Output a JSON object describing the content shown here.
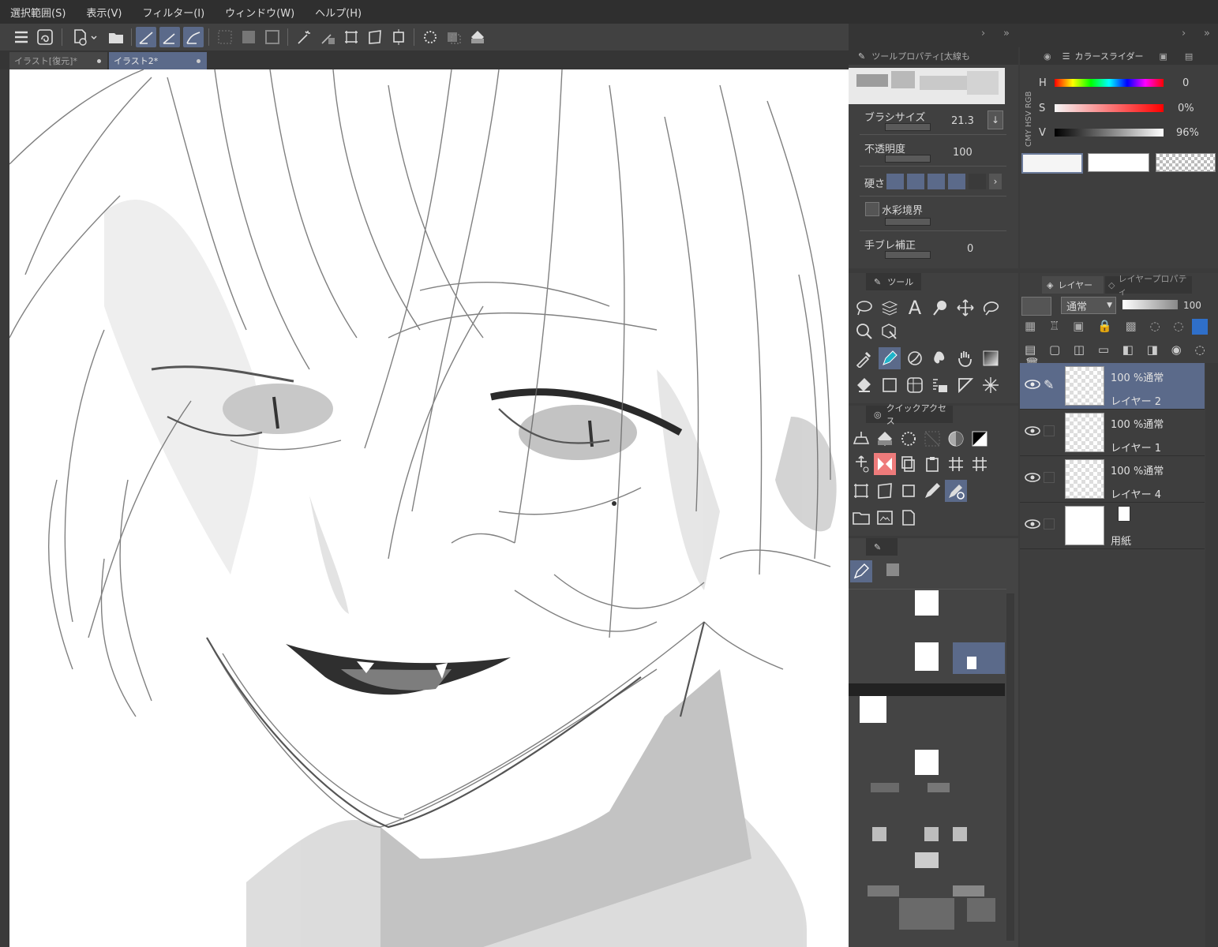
{
  "menu": [
    "選択範囲(S)",
    "表示(V)",
    "フィルター(I)",
    "ウィンドウ(W)",
    "ヘルプ(H)"
  ],
  "tabs": [
    {
      "label": "イラスト[復元]*",
      "active": false
    },
    {
      "label": "イラスト2*",
      "active": true
    }
  ],
  "tool_property": {
    "header": "ツールプロパティ[太線も",
    "brush_size_label": "ブラシサイズ",
    "brush_size_value": "21.3",
    "opacity_label": "不透明度",
    "opacity_value": "100",
    "hardness_label": "硬さ",
    "watercolor_edge_label": "水彩境界",
    "stabilization_label": "手ブレ補正",
    "stabilization_value": "0"
  },
  "color_slider": {
    "header": "カラースライダー",
    "side_tabs": [
      "RGB",
      "HSV",
      "CMY"
    ],
    "h_label": "H",
    "h_value": "0",
    "s_label": "S",
    "s_value": "0%",
    "v_label": "V",
    "v_value": "96%",
    "main_color": "#f5f5f5",
    "sub_color": "#ffffff"
  },
  "tool_panel": {
    "header": "ツール"
  },
  "quick_access": {
    "header": "クイックアクセス"
  },
  "layer_panel": {
    "tab_layer": "レイヤー",
    "tab_property": "レイヤープロパティ",
    "blend_mode": "通常",
    "opacity": "100",
    "layers": [
      {
        "mode": "100 %通常",
        "name": "レイヤー 2",
        "selected": true
      },
      {
        "mode": "100 %通常",
        "name": "レイヤー 1",
        "selected": false
      },
      {
        "mode": "100 %通常",
        "name": "レイヤー 4",
        "selected": false
      },
      {
        "mode": "",
        "name": "用紙",
        "selected": false
      }
    ]
  },
  "colors": {
    "accent": "#5b6a8a",
    "panel_bg": "#404040",
    "canvas_bg": "#ffffff"
  }
}
